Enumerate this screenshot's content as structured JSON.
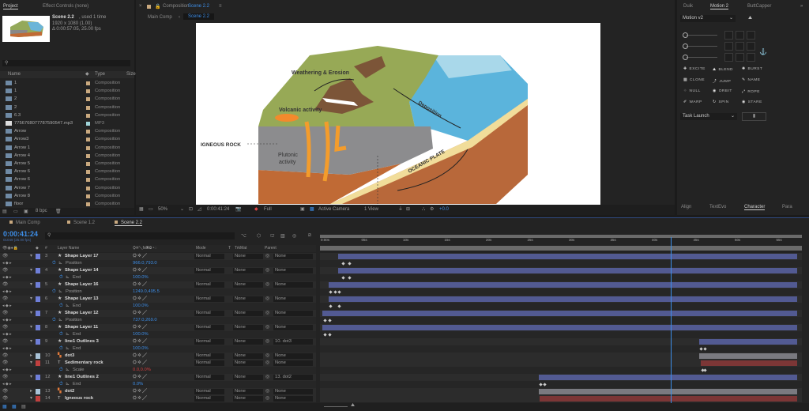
{
  "project": {
    "tab": "Project",
    "tab2": "Effect Controls (none)",
    "comp_name": "Scene 2.2",
    "used": ", used 1 time",
    "size": "1920 x 1080 (1.00)",
    "duration": "Δ 0:00:57:05, 25.00 fps",
    "search_placeholder": "",
    "columns": {
      "name": "Name",
      "type": "Type",
      "size": "Size"
    },
    "items": [
      {
        "name": "1",
        "type": "Composition",
        "icon": "composition-icon"
      },
      {
        "name": "1",
        "type": "Composition",
        "icon": "composition-icon"
      },
      {
        "name": "2",
        "type": "Composition",
        "icon": "composition-icon"
      },
      {
        "name": "2",
        "type": "Composition",
        "icon": "composition-icon"
      },
      {
        "name": "6.3",
        "type": "Composition",
        "icon": "composition-icon"
      },
      {
        "name": "7756768077787590547.mp3",
        "type": "MP3",
        "icon": "audio-file-icon"
      },
      {
        "name": "Arrow",
        "type": "Composition",
        "icon": "composition-icon"
      },
      {
        "name": "Arrow3",
        "type": "Composition",
        "icon": "composition-icon"
      },
      {
        "name": "Arrow 1",
        "type": "Composition",
        "icon": "composition-icon"
      },
      {
        "name": "Arrow 4",
        "type": "Composition",
        "icon": "composition-icon"
      },
      {
        "name": "Arrow 5",
        "type": "Composition",
        "icon": "composition-icon"
      },
      {
        "name": "Arrow 6",
        "type": "Composition",
        "icon": "composition-icon"
      },
      {
        "name": "Arrow 6",
        "type": "Composition",
        "icon": "composition-icon"
      },
      {
        "name": "Arrow 7",
        "type": "Composition",
        "icon": "composition-icon"
      },
      {
        "name": "Arrow 8",
        "type": "Composition",
        "icon": "composition-icon"
      },
      {
        "name": "floor",
        "type": "Composition",
        "icon": "composition-icon"
      }
    ],
    "bpc": "8 bpc"
  },
  "composition": {
    "tab_prefix": "Composition",
    "tab_name": "Scene 2.2",
    "breadcrumb": [
      "Main Comp",
      "Scene 2.2"
    ],
    "labels": {
      "weathering": "Weathering & Erosion",
      "volcanic": "Volcanic activity",
      "deposition": "Deposition",
      "igneous": "IGNEOUS ROCK",
      "plutonic1": "Plutonic",
      "plutonic2": "activity",
      "oceanic": "OCEANIC PLATE"
    },
    "footer": {
      "zoom": "50%",
      "timecode": "0:00:41:24",
      "resolution": "Full",
      "camera": "Active Camera",
      "views": "1 View",
      "exposure": "+0.0"
    }
  },
  "right_panel": {
    "tabs": [
      "Duik",
      "Motion 2",
      "ButtCapper"
    ],
    "preset": "Motion v2",
    "buttons": [
      "EXCITE",
      "BLEND",
      "BURST",
      "CLONE",
      "JUMP",
      "NAME",
      "NULL",
      "ORBIT",
      "ROPE",
      "WARP",
      "SPIN",
      "STARE"
    ],
    "task": "Task Launch",
    "bottom_tabs": [
      "Align",
      "TextEvo",
      "Character",
      "Para"
    ]
  },
  "timeline": {
    "tabs": [
      "Main Comp",
      "Scene 1.2",
      "Scene 2.2"
    ],
    "timecode": "0:00:41:24",
    "fps": "01049 (25.00 fps)",
    "headers": {
      "num": "#",
      "name": "Layer Name",
      "mode": "Mode",
      "t": "T",
      "trkmat": "TrkMat",
      "parent": "Parent"
    },
    "ruler": [
      "0:00s",
      "05s",
      "10s",
      "15s",
      "20s",
      "25s",
      "30s",
      "35s",
      "40s",
      "45s",
      "50s",
      "55s"
    ],
    "current_time_s": 41.96,
    "duration_s": 57.2,
    "layers": [
      {
        "num": "3",
        "name": "Shape Layer 17",
        "type": "shape",
        "color": "#6f7fd8",
        "mode": "Normal",
        "trkmat": "None",
        "parent": "None",
        "prop": "Position",
        "value": "966.0,793.0",
        "start": 1.9,
        "keys": [
          2.4,
          3.1
        ],
        "bar": "#525a92"
      },
      {
        "num": "4",
        "name": "Shape Layer 14",
        "type": "shape",
        "color": "#6f7fd8",
        "mode": "Normal",
        "trkmat": "None",
        "parent": "None",
        "prop": "End",
        "value": "100.0%",
        "start": 1.9,
        "keys": [
          2.4,
          3.1
        ],
        "bar": "#525a92"
      },
      {
        "num": "5",
        "name": "Shape Layer 16",
        "type": "shape",
        "color": "#6f7fd8",
        "mode": "Normal",
        "trkmat": "None",
        "parent": "None",
        "prop": "Position",
        "value": "1249.0,495.5",
        "start": 0.8,
        "keys": [
          0.9,
          1.4,
          1.9
        ],
        "bar": "#525a92"
      },
      {
        "num": "6",
        "name": "Shape Layer 13",
        "type": "shape",
        "color": "#6f7fd8",
        "mode": "Normal",
        "trkmat": "None",
        "parent": "None",
        "prop": "End",
        "value": "100.0%",
        "start": 0.8,
        "keys": [
          0.9,
          1.9
        ],
        "bar": "#525a92"
      },
      {
        "num": "7",
        "name": "Shape Layer 12",
        "type": "shape",
        "color": "#6f7fd8",
        "mode": "Normal",
        "trkmat": "None",
        "parent": "None",
        "prop": "Position",
        "value": "737.0,269.0",
        "start": 0,
        "keys": [
          0.2,
          0.8
        ],
        "bar": "#525a92"
      },
      {
        "num": "8",
        "name": "Shape Layer 11",
        "type": "shape",
        "color": "#6f7fd8",
        "mode": "Normal",
        "trkmat": "None",
        "parent": "None",
        "prop": "End",
        "value": "100.0%",
        "start": 0,
        "keys": [
          0.2,
          0.8
        ],
        "bar": "#525a92"
      },
      {
        "num": "9",
        "name": "line1 Outlines 3",
        "type": "shape",
        "color": "#6f7fd8",
        "mode": "Normal",
        "trkmat": "None",
        "parent": "10. dot3",
        "prop": "End",
        "value": "100.0%",
        "start": 45.4,
        "keys": [
          45.5,
          46.0
        ],
        "bar": "#525a92"
      },
      {
        "num": "10",
        "name": "dot3",
        "type": "precomp",
        "color": "#a9c3d8",
        "mode": "Normal",
        "trkmat": "None",
        "parent": "None",
        "start": 45.4,
        "bar": "#7a7a80",
        "collapsed": true
      },
      {
        "num": "11",
        "name": "Sedimentary rock",
        "type": "text",
        "color": "#c0403f",
        "mode": "Normal",
        "trkmat": "None",
        "parent": "None",
        "prop": "Scale",
        "value": "0.0,0.0%",
        "value_color": "#d04040",
        "start": 45.6,
        "keys": [
          45.7,
          46.0
        ],
        "bar": "#7c3636"
      },
      {
        "num": "12",
        "name": "line1 Outlines 2",
        "type": "shape",
        "color": "#6f7fd8",
        "mode": "Normal",
        "trkmat": "None",
        "parent": "13. dot2",
        "prop": "End",
        "value": "0.0%",
        "start": 26.1,
        "keys": [
          26.2,
          26.7
        ],
        "bar": "#525a92"
      },
      {
        "num": "13",
        "name": "dot2",
        "type": "precomp",
        "color": "#a9c3d8",
        "mode": "Normal",
        "trkmat": "None",
        "parent": "None",
        "start": 26.1,
        "bar": "#7a7a80",
        "collapsed": true
      },
      {
        "num": "14",
        "name": "Igneous rock",
        "type": "text",
        "color": "#c0403f",
        "mode": "Normal",
        "trkmat": "None",
        "parent": "None",
        "start": 26.2,
        "bar": "#7c3636"
      }
    ]
  }
}
